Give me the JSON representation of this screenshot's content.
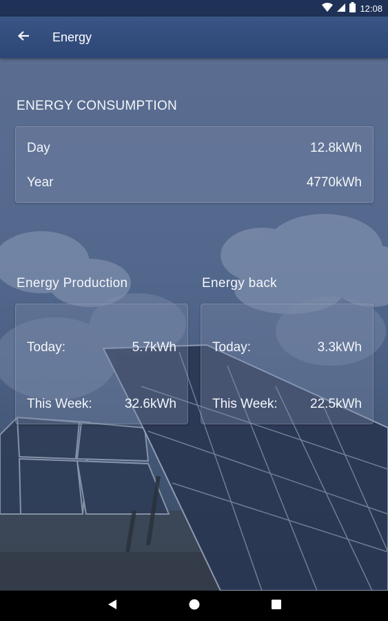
{
  "status_bar": {
    "time": "12:08",
    "icons": [
      "wifi-icon",
      "signal-icon",
      "battery-icon"
    ]
  },
  "app_bar": {
    "title": "Energy",
    "back_icon": "arrow-left-icon"
  },
  "consumption": {
    "title": "ENERGY CONSUMPTION",
    "rows": [
      {
        "label": "Day",
        "value": "12.8kWh"
      },
      {
        "label": "Year",
        "value": "4770kWh"
      }
    ]
  },
  "production": {
    "title": "Energy Production",
    "rows": [
      {
        "label": "Today:",
        "value": "5.7kWh"
      },
      {
        "label": "This Week:",
        "value": "32.6kWh"
      }
    ]
  },
  "energy_back": {
    "title": "Energy back",
    "rows": [
      {
        "label": "Today:",
        "value": "3.3kWh"
      },
      {
        "label": "This Week:",
        "value": "22.5kWh"
      }
    ]
  },
  "nav_bar": {
    "icons": [
      "back-triangle-icon",
      "home-circle-icon",
      "recents-square-icon"
    ]
  }
}
